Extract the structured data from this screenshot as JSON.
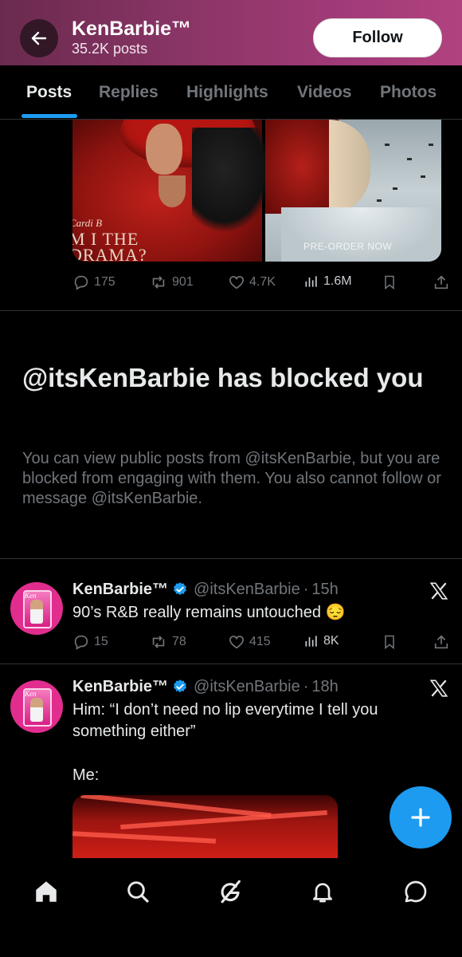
{
  "header": {
    "display_name": "KenBarbie™",
    "post_count": "35.2K posts",
    "follow_label": "Follow"
  },
  "tabs": [
    {
      "label": "Posts",
      "active": true
    },
    {
      "label": "Replies",
      "active": false
    },
    {
      "label": "Highlights",
      "active": false
    },
    {
      "label": "Videos",
      "active": false
    },
    {
      "label": "Photos",
      "active": false
    }
  ],
  "media_post": {
    "album_credit": "Cardi B",
    "album_title_line1": "M I THE",
    "album_title_line2": "DRAMA?",
    "preorder_text": "PRE-ORDER NOW",
    "replies": "175",
    "reposts": "901",
    "likes": "4.7K",
    "views": "1.6M"
  },
  "blocked": {
    "title": "@itsKenBarbie has blocked you",
    "message": "You can view public posts from @itsKenBarbie, but you are blocked from engaging with them. You also cannot follow or message @itsKenBarbie."
  },
  "posts": [
    {
      "name": "KenBarbie™",
      "handle": "@itsKenBarbie",
      "dot": "·",
      "time": "15h",
      "text": "90’s R&B really remains untouched 😔",
      "replies": "15",
      "reposts": "78",
      "likes": "415",
      "views": "8K"
    },
    {
      "name": "KenBarbie™",
      "handle": "@itsKenBarbie",
      "dot": "·",
      "time": "18h",
      "text": "Him: “I don’t need no lip everytime I tell you something either”",
      "text2": "Me:"
    }
  ],
  "icons": {
    "back": "arrow-left-icon",
    "reply": "comment-icon",
    "repost": "repost-icon",
    "like": "heart-icon",
    "views": "bar-chart-icon",
    "bookmark": "bookmark-icon",
    "share": "share-icon",
    "verified": "verified-badge-icon",
    "x_logo": "x-logo-icon",
    "compose": "plus-icon",
    "nav": [
      "home-icon",
      "search-icon",
      "grok-icon",
      "notifications-icon",
      "messages-icon"
    ]
  },
  "colors": {
    "accent": "#1d9bf0",
    "background": "#000000",
    "muted_text": "#71767b",
    "primary_text": "#e7e9ea"
  }
}
